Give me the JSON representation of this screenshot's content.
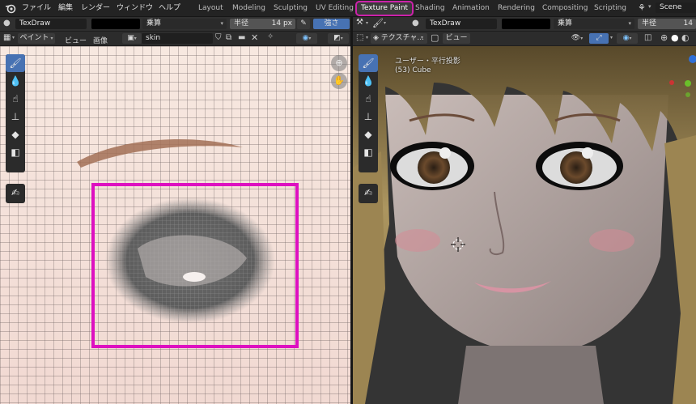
{
  "menubar": {
    "items": [
      "ファイル",
      "編集",
      "レンダー",
      "ウィンドウ",
      "ヘルプ"
    ],
    "workspaces": [
      "Layout",
      "Modeling",
      "Sculpting",
      "UV Editing",
      "Texture Paint",
      "Shading",
      "Animation",
      "Rendering",
      "Compositing",
      "Scripting"
    ],
    "active_workspace": "Texture Paint",
    "scene": "Scene"
  },
  "image_editor": {
    "brush_name": "TexDraw",
    "blend_mode": "乗算",
    "radius_label": "半径",
    "radius_value": "14 px",
    "strength_label": "強さ",
    "mode": "ペイント",
    "view_menu": "ビュー",
    "image_menu": "画像",
    "image_name": "skin"
  },
  "viewport": {
    "mode": "テクスチャ...",
    "brush_name": "TexDraw",
    "view_menu": "ビュー",
    "blend_mode": "乗算",
    "radius_label": "半径",
    "radius_value": "14",
    "view_label": "ユーザー・平行投影",
    "object_label": "(53) Cube"
  },
  "colors": {
    "accent": "#4772b3",
    "highlight_box": "#dd10c0",
    "brush_color": "#000000"
  }
}
